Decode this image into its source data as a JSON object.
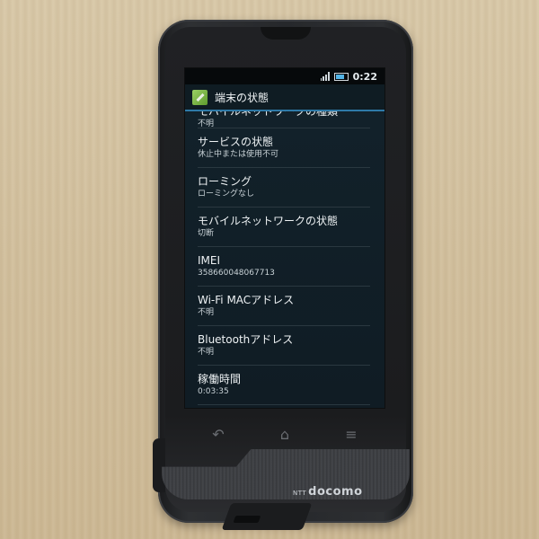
{
  "status_bar": {
    "time": "0:22"
  },
  "header": {
    "title": "端末の状態",
    "icon": "wrench-icon"
  },
  "items": [
    {
      "label": "モバイルネットワークの種類",
      "value": "不明"
    },
    {
      "label": "サービスの状態",
      "value": "休止中または使用不可"
    },
    {
      "label": "ローミング",
      "value": "ローミングなし"
    },
    {
      "label": "モバイルネットワークの状態",
      "value": "切断"
    },
    {
      "label": "IMEI",
      "value": "358660048067713"
    },
    {
      "label": "Wi-Fi MACアドレス",
      "value": "不明"
    },
    {
      "label": "Bluetoothアドレス",
      "value": "不明"
    },
    {
      "label": "稼働時間",
      "value": "0:03:35"
    }
  ],
  "nav": {
    "back_icon": "back-arrow-icon",
    "home_icon": "home-icon",
    "menu_icon": "menu-icon"
  },
  "brand": {
    "prefix": "NTT",
    "name": "docomo"
  },
  "colors": {
    "accent": "#2e7aa8",
    "screen_bg": "#12222b"
  }
}
